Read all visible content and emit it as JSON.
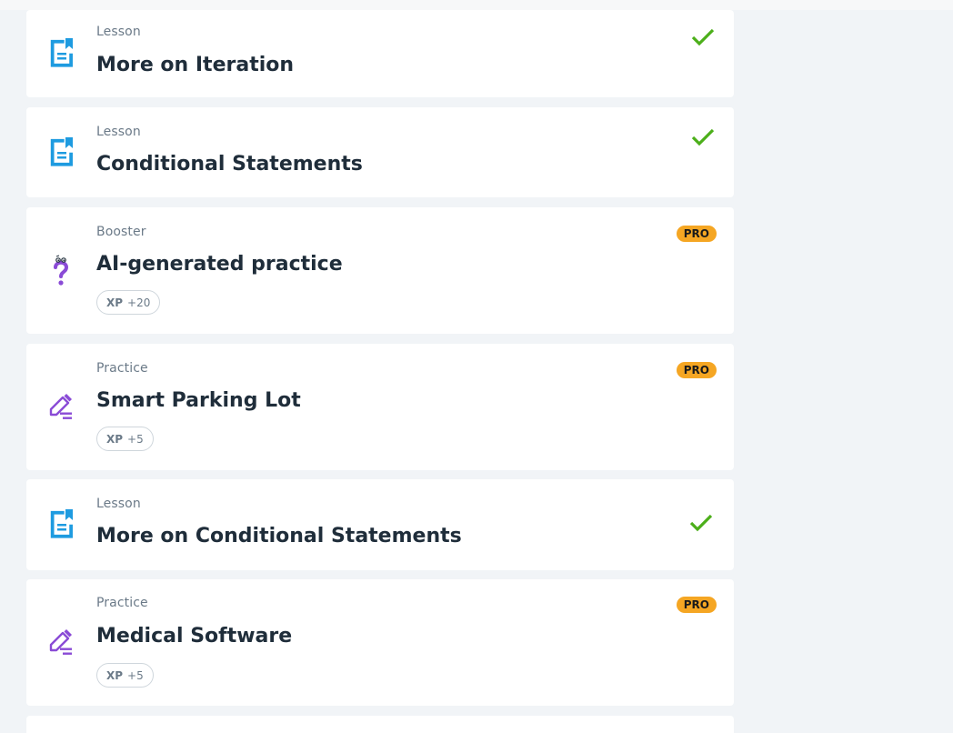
{
  "colors": {
    "lesson_icon": "#1e9be0",
    "practice_icon": "#8a4bd6",
    "booster_icon": "#8a4bd6",
    "check": "#4caf1a",
    "pro_badge": "#f5a623"
  },
  "items": [
    {
      "type": "Lesson",
      "title": "More on Iteration",
      "icon": "lesson-document-icon",
      "status": "completed"
    },
    {
      "type": "Lesson",
      "title": "Conditional Statements",
      "icon": "lesson-document-icon",
      "status": "completed"
    },
    {
      "type": "Booster",
      "title": "AI-generated practice",
      "icon": "question-mark-icon",
      "badge": "PRO",
      "xp_label": "XP",
      "xp_value": "+20"
    },
    {
      "type": "Practice",
      "title": "Smart Parking Lot",
      "icon": "pencil-edit-icon",
      "badge": "PRO",
      "xp_label": "XP",
      "xp_value": "+5"
    },
    {
      "type": "Lesson",
      "title": "More on Conditional Statements",
      "icon": "lesson-document-icon",
      "status": "completed"
    },
    {
      "type": "Practice",
      "title": "Medical Software",
      "icon": "pencil-edit-icon",
      "badge": "PRO",
      "xp_label": "XP",
      "xp_value": "+5"
    }
  ]
}
